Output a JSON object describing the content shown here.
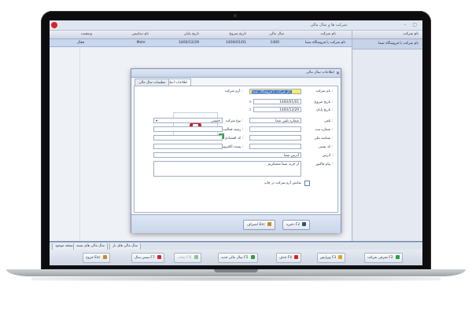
{
  "app": {
    "title": "شرکت ها و سال مالی"
  },
  "grid": {
    "columns": [
      "نام شرکت",
      "سال مالی",
      "تاریخ شروع",
      "تاریخ پایان",
      "نام دیتابیس",
      "وضعیت"
    ],
    "row": [
      "نام شرکت یا فروشگاه شما",
      "1400",
      "1400/01/01",
      "1400/12/29",
      "Mohr",
      "فعال"
    ]
  },
  "side": {
    "header": "نام شرکت",
    "item": "نام شرکت یا فروشگاه شما"
  },
  "bottom_tabs": [
    "نسخه موجود",
    "سال مالی های بسته",
    "سال مالی های باز"
  ],
  "toolbar": {
    "buttons": [
      {
        "label": "معرفی شرکت F2",
        "icon": "plus-icon",
        "color": "#2e9f3a",
        "disabled": false
      },
      {
        "label": "ویرایش F3",
        "icon": "edit-icon",
        "color": "#e0a21f",
        "disabled": false
      },
      {
        "label": "حذف F4",
        "icon": "delete-icon",
        "color": "#d0262c",
        "disabled": false
      },
      {
        "label": "سال مالی جدید F5",
        "icon": "plus-icon",
        "color": "#2e9f3a",
        "disabled": false
      },
      {
        "label": "انتخاب F6",
        "icon": "check-icon",
        "color": "#6ab46f",
        "disabled": true
      },
      {
        "label": "بستن سال F7",
        "icon": "lock-icon",
        "color": "#d0262c",
        "disabled": false
      },
      {
        "label": "خروج Esc",
        "icon": "exit-icon",
        "color": "#c58a2a",
        "disabled": false
      }
    ]
  },
  "dialog": {
    "title": "اطلاعات سال مالی",
    "tabs": [
      "اطلاعات اصلی",
      "تنظیمات سال مالی"
    ],
    "fields": {
      "company_name_label": "نام شرکت :",
      "company_name_value": "نام شرکت یا فروشگاه شما",
      "logo_label": "آرم شرکت :",
      "start_date_label": "تاریخ شروع :",
      "start_date_value": "1400/01/01",
      "end_date_label": "تاریخ پایان :",
      "end_date_value": "1400/12/29",
      "phone_label": "تلفن :",
      "phone_value": "شماره تلفن شما",
      "company_type_label": "نوع شرکت :",
      "company_type_value": "حقیقی",
      "activity_type_label": "زمینه فعالیت :",
      "economic_code_label": "کد اقتصادی :",
      "registration_label": "شماره ثبت :",
      "national_id_label": "شناسه ملی :",
      "postal_code_label": "کد پستی :",
      "email_label": "پست الکترونیکی :",
      "address_label": "آدرس :",
      "address_value": "آدرس شما",
      "invoice_msg_label": "پیام فاکتور :",
      "invoice_msg_value": "از خرید شما متشکریم",
      "print_logo_label": "نمایش آرم شرکت در چاپ"
    },
    "buttons": {
      "save": "ذخیره F2",
      "cancel": "انصراف Esc"
    }
  }
}
